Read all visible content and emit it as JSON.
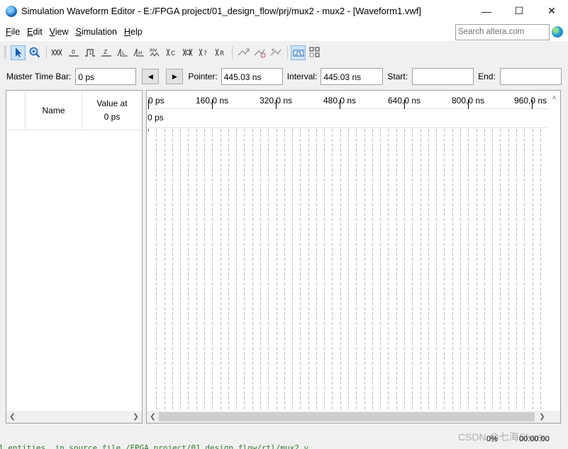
{
  "window": {
    "title": "Simulation Waveform Editor - E:/FPGA project/01_design_flow/prj/mux2 - mux2 - [Waveform1.vwf]",
    "minimize": "—",
    "maximize": "☐",
    "close": "✕"
  },
  "menu": {
    "items": [
      {
        "key": "F",
        "rest": "ile"
      },
      {
        "key": "E",
        "rest": "dit"
      },
      {
        "key": "V",
        "rest": "iew"
      },
      {
        "key": "S",
        "rest": "imulation"
      },
      {
        "key": "H",
        "rest": "elp"
      }
    ],
    "search_placeholder": "Search altera.com"
  },
  "toolbar": {
    "icons": [
      "selection-tool-icon",
      "zoom-tool-icon",
      "forcing-unknown-icon",
      "forcing-low-icon",
      "forcing-high-icon",
      "high-impedance-icon",
      "weak-low-icon",
      "weak-high-icon",
      "invert-icon",
      "count-value-icon",
      "clock-icon",
      "random-value-icon",
      "arbitrary-value-icon",
      "snap-icon",
      "run-functional-icon",
      "run-timing-icon",
      "run-timing-netlist-icon",
      "grid-snap-icon",
      "group-icon"
    ]
  },
  "timebar": {
    "master_label": "Master Time Bar:",
    "master_value": "0 ps",
    "prev_symbol": "◀",
    "next_symbol": "▶",
    "pointer_label": "Pointer:",
    "pointer_value": "445.03 ns",
    "interval_label": "Interval:",
    "interval_value": "445.03 ns",
    "start_label": "Start:",
    "start_value": "",
    "end_label": "End:",
    "end_value": ""
  },
  "signals_table": {
    "name_header": "Name",
    "value_header_line1": "Value at",
    "value_header_line2": "0 ps"
  },
  "waveform": {
    "ruler_ticks": [
      "0 ps",
      "160,0 ns",
      "320,0 ns",
      "480,0 ns",
      "640,0 ns",
      "800,0 ns",
      "960,0 ns"
    ],
    "cursor_label": "0 ps"
  },
  "status": {
    "log_text": "1 entities, in source file /FPGA project/01_design_flow/rtl/mux2.v",
    "progress": "0%",
    "elapsed": "00:00:00",
    "watermark": "CSDN @七海Shark"
  }
}
